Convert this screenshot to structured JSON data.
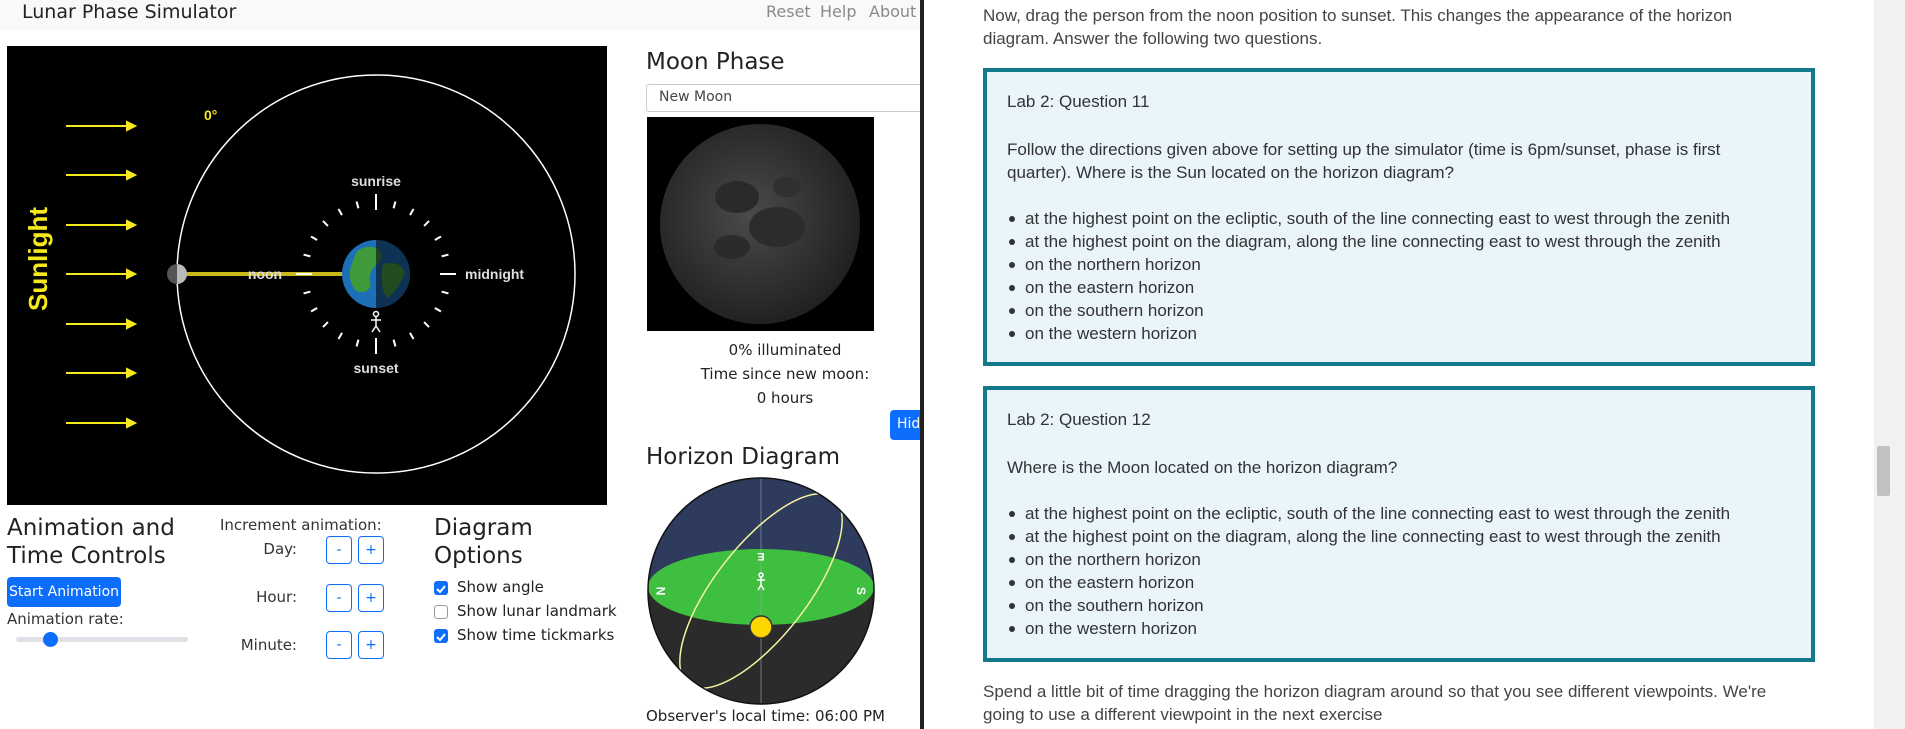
{
  "app": {
    "title": "Lunar Phase Simulator",
    "nav": [
      "Reset",
      "Help",
      "About"
    ]
  },
  "orbit": {
    "angle_label": "0°",
    "sunlight_label": "Sunlight",
    "labels": {
      "sunrise": "sunrise",
      "noon": "noon",
      "midnight": "midnight",
      "sunset": "sunset"
    }
  },
  "moon_phase": {
    "heading": "Moon Phase",
    "selected": "New Moon",
    "illuminated": "0% illuminated",
    "time_since_label": "Time since new moon:",
    "time_since_value": "0 hours"
  },
  "hide_button": "Hid",
  "horizon": {
    "heading": "Horizon Diagram",
    "north_label": "N",
    "south_label": "S",
    "zenith_label": "E",
    "observer_time": "Observer's local time: 06:00 PM"
  },
  "animation": {
    "heading_line1": "Animation and",
    "heading_line2": "Time Controls",
    "start_button": "Start Animation",
    "rate_label": "Animation rate:",
    "rate_value": 0.2,
    "increment_label": "Increment animation:",
    "rows": [
      {
        "label": "Day:",
        "minus": "-",
        "plus": "+"
      },
      {
        "label": "Hour:",
        "minus": "-",
        "plus": "+"
      },
      {
        "label": "Minute:",
        "minus": "-",
        "plus": "+"
      }
    ]
  },
  "diagram_options": {
    "heading_line1": "Diagram",
    "heading_line2": "Options",
    "options": [
      {
        "label": "Show angle",
        "checked": true
      },
      {
        "label": "Show lunar landmark",
        "checked": false
      },
      {
        "label": "Show time tickmarks",
        "checked": true
      }
    ]
  },
  "content": {
    "intro": "Now, drag the person from the noon position to sunset.  This changes the appearance of the horizon diagram.  Answer the following two questions.",
    "q11": {
      "title": "Lab 2: Question 11",
      "text": "Follow the directions given above for setting up the simulator (time is 6pm/sunset, phase is first quarter).  Where is the Sun located on the horizon diagram?",
      "options": [
        "at the highest point on the ecliptic, south of the line connecting east to west through the zenith",
        "at the highest point on the diagram, along the line connecting east to west through the zenith",
        "on the northern horizon",
        "on the eastern horizon",
        "on the southern horizon",
        "on the western horizon"
      ]
    },
    "q12": {
      "title": "Lab 2: Question 12",
      "text": "Where is the Moon located on the horizon diagram?",
      "options": [
        "at the highest point on the ecliptic, south of the line connecting east to west through the zenith",
        "at the highest point on the diagram, along the line connecting east to west through the zenith",
        "on the northern horizon",
        "on the eastern horizon",
        "on the southern horizon",
        "on the western horizon"
      ]
    },
    "outro": "Spend a little bit of time dragging the horizon diagram around so that you see different viewpoints. We're going to use a different viewpoint in the next exercise"
  },
  "colors": {
    "accent": "#0d6efd",
    "question_border": "#117a8b",
    "question_bg": "#eaf4fb",
    "sunlight": "#f5e81c",
    "horizon_ground": "#3fbf3f",
    "horizon_sky": "#2f3b5c"
  }
}
